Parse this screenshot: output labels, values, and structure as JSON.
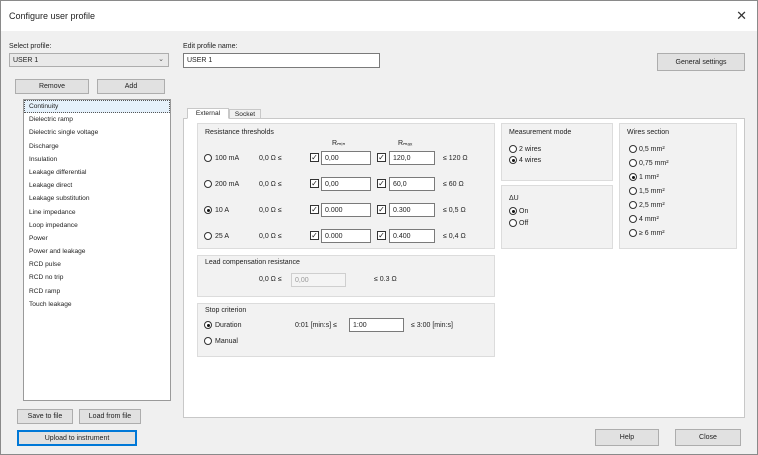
{
  "window": {
    "title": "Configure user profile",
    "close_glyph": "✕"
  },
  "profile": {
    "select_label": "Select profile:",
    "selected": "USER 1",
    "remove_label": "Remove",
    "add_label": "Add",
    "edit_label": "Edit profile name:",
    "name_value": "USER 1"
  },
  "general_settings_label": "General settings",
  "test_list": [
    "Continuity",
    "Dielectric ramp",
    "Dielectric single voltage",
    "Discharge",
    "Insulation",
    "Leakage differential",
    "Leakage direct",
    "Leakage substitution",
    "Line impedance",
    "Loop impedance",
    "Power",
    "Power and leakage",
    "RCD pulse",
    "RCD no trip",
    "RCD ramp",
    "Touch leakage"
  ],
  "tabs": [
    "External",
    "Socket"
  ],
  "thresholds": {
    "title": "Resistance thresholds",
    "col_min": "Rₘᵢₙ",
    "col_max": "Rₘₐₓ",
    "rows": [
      {
        "current": "100 mA",
        "lower": "0,0 Ω ≤",
        "min": "0,00",
        "max": "120,0",
        "upper": "≤ 120 Ω",
        "selected": false
      },
      {
        "current": "200 mA",
        "lower": "0,0 Ω ≤",
        "min": "0,00",
        "max": "60,0",
        "upper": "≤ 60 Ω",
        "selected": false
      },
      {
        "current": "10 A",
        "lower": "0,0 Ω ≤",
        "min": "0.000",
        "max": "0.300",
        "upper": "≤ 0,5 Ω",
        "selected": true
      },
      {
        "current": "25 A",
        "lower": "0,0 Ω ≤",
        "min": "0.000",
        "max": "0.400",
        "upper": "≤ 0,4 Ω",
        "selected": false
      }
    ],
    "check_glyph": "✓"
  },
  "lead_comp": {
    "title": "Lead compensation resistance",
    "lower": "0,0 Ω ≤",
    "value": "0,00",
    "upper": "≤ 0.3 Ω"
  },
  "stop": {
    "title": "Stop criterion",
    "duration_label": "Duration",
    "manual_label": "Manual",
    "range_lower": "0:01 [min:s] ≤",
    "value": "1:00",
    "range_upper": "≤ 3:00 [min:s]",
    "selected": "duration"
  },
  "measurement_mode": {
    "title": "Measurement mode",
    "options": [
      "2 wires",
      "4 wires"
    ],
    "selected_index": 1
  },
  "delta_u": {
    "title": "ΔU",
    "options": [
      "On",
      "Off"
    ],
    "selected_index": 0
  },
  "wire_section": {
    "title": "Wires section",
    "options": [
      "0,5 mm²",
      "0,75 mm²",
      "1 mm²",
      "1,5 mm²",
      "2,5 mm²",
      "4 mm²",
      "≥ 6 mm²"
    ],
    "selected_index": 2
  },
  "bottom": {
    "save_label": "Save to file",
    "load_label": "Load from file",
    "upload_label": "Upload to instrument",
    "help_label": "Help",
    "close_label": "Close"
  }
}
